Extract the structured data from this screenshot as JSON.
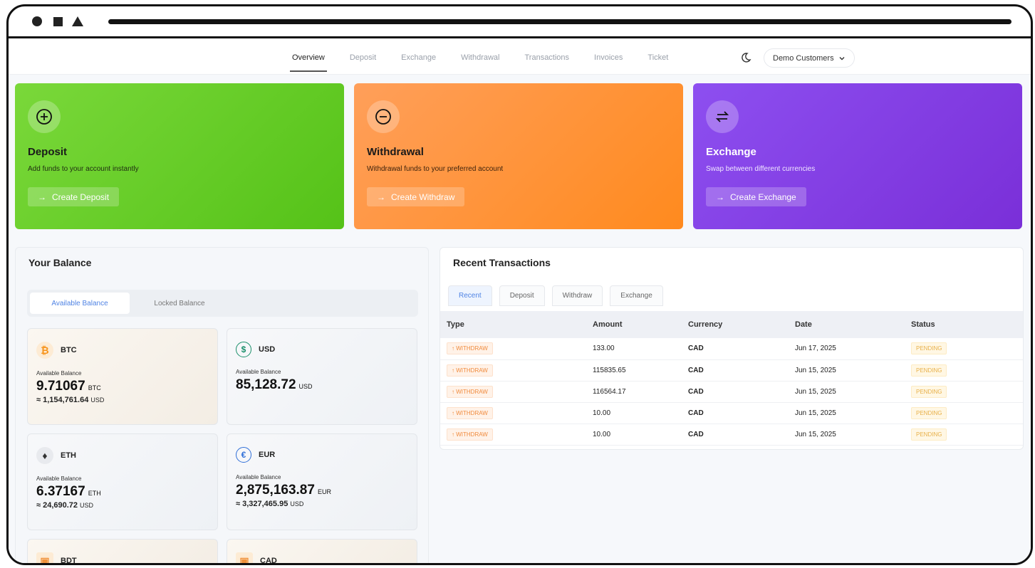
{
  "nav": {
    "links": [
      "Overview",
      "Deposit",
      "Exchange",
      "Withdrawal",
      "Transactions",
      "Invoices",
      "Ticket"
    ],
    "active": "Overview",
    "customer": "Demo Customers"
  },
  "actions": [
    {
      "title": "Deposit",
      "subtitle": "Add funds to your account instantly",
      "button": "Create Deposit",
      "icon": "plus-circle-icon"
    },
    {
      "title": "Withdrawal",
      "subtitle": "Withdrawal funds to your preferred account",
      "button": "Create Withdraw",
      "icon": "minus-circle-icon"
    },
    {
      "title": "Exchange",
      "subtitle": "Swap between different currencies",
      "button": "Create Exchange",
      "icon": "swap-icon"
    }
  ],
  "balance": {
    "title": "Your Balance",
    "tabs": [
      "Available Balance",
      "Locked Balance"
    ],
    "label": "Available Balance",
    "tiles": [
      {
        "code": "BTC",
        "amount": "9.71067",
        "unit": "BTC",
        "usd": "≈ 1,154,761.64",
        "usd_unit": "USD",
        "glyph": "₿"
      },
      {
        "code": "USD",
        "amount": "85,128.72",
        "unit": "USD",
        "usd": "",
        "usd_unit": "",
        "glyph": "$"
      },
      {
        "code": "ETH",
        "amount": "6.37167",
        "unit": "ETH",
        "usd": "≈ 24,690.72",
        "usd_unit": "USD",
        "glyph": "♦"
      },
      {
        "code": "EUR",
        "amount": "2,875,163.87",
        "unit": "EUR",
        "usd": "≈ 3,327,465.95",
        "usd_unit": "USD",
        "glyph": "€"
      },
      {
        "code": "BDT",
        "glyph": "▣"
      },
      {
        "code": "CAD",
        "glyph": "▣"
      }
    ]
  },
  "recent": {
    "title": "Recent Transactions",
    "tabs": [
      "Recent",
      "Deposit",
      "Withdraw",
      "Exchange"
    ],
    "columns": [
      "Type",
      "Amount",
      "Currency",
      "Date",
      "Status"
    ],
    "rows": [
      {
        "type": "↑ WITHDRAW",
        "amount": "133.00",
        "currency": "CAD",
        "date": "Jun 17, 2025",
        "status": "PENDING"
      },
      {
        "type": "↑ WITHDRAW",
        "amount": "115835.65",
        "currency": "CAD",
        "date": "Jun 15, 2025",
        "status": "PENDING"
      },
      {
        "type": "↑ WITHDRAW",
        "amount": "116564.17",
        "currency": "CAD",
        "date": "Jun 15, 2025",
        "status": "PENDING"
      },
      {
        "type": "↑ WITHDRAW",
        "amount": "10.00",
        "currency": "CAD",
        "date": "Jun 15, 2025",
        "status": "PENDING"
      },
      {
        "type": "↑ WITHDRAW",
        "amount": "10.00",
        "currency": "CAD",
        "date": "Jun 15, 2025",
        "status": "PENDING"
      }
    ]
  }
}
